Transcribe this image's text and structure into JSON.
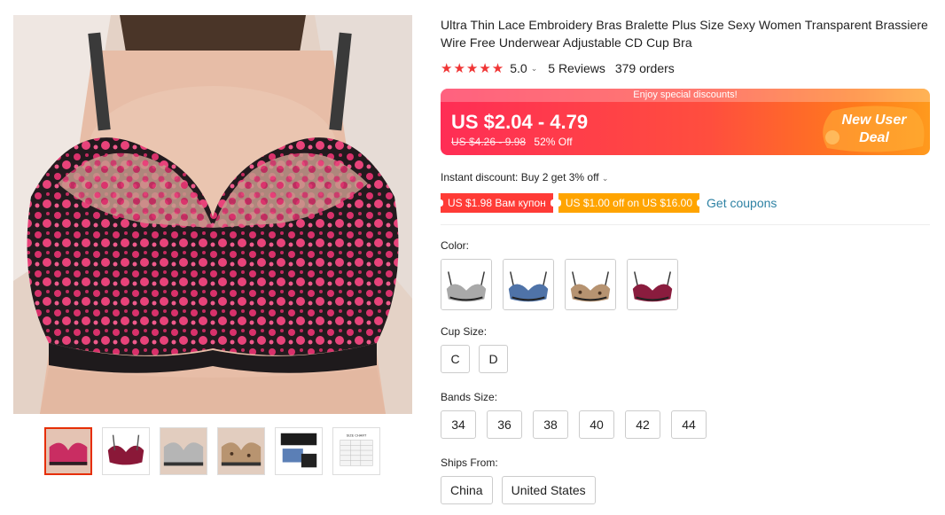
{
  "product": {
    "title": "Ultra Thin Lace Embroidery Bras Bralette Plus Size Sexy Women Transparent Brassiere Wire Free Underwear Adjustable CD Cup Bra",
    "stars": "★★★★★",
    "rating": "5.0",
    "reviews": "5 Reviews",
    "orders": "379 orders"
  },
  "price": {
    "banner_note": "Enjoy special discounts!",
    "current": "US $2.04 - 4.79",
    "original": "US $4.26 - 9.98",
    "discount": "52% Off",
    "deal_line1": "New User",
    "deal_line2": "Deal"
  },
  "promo": {
    "instant": "Instant discount: Buy 2 get 3% off",
    "coupon1": "US $1.98 Вам купон",
    "coupon2": "US $1.00 off on US $16.00",
    "get_coupons": "Get coupons"
  },
  "options": {
    "color_label": "Color:",
    "colors": [
      "grey",
      "blue",
      "leopard",
      "burgundy"
    ],
    "cup_label": "Cup Size:",
    "cups": [
      "C",
      "D"
    ],
    "band_label": "Bands Size:",
    "bands": [
      "34",
      "36",
      "38",
      "40",
      "42",
      "44"
    ],
    "ship_label": "Ships From:",
    "ships": [
      "China",
      "United States"
    ]
  },
  "gallery": {
    "thumbs": [
      "pink-main",
      "burgundy",
      "grey",
      "leopard",
      "product-set",
      "size-chart"
    ],
    "size_chart_label": "SIZE CHART"
  },
  "colors": {
    "accent": "#e62e04",
    "star": "#f03535",
    "link": "#2e82a4",
    "coupon_red": "#ff3b36",
    "coupon_orange": "#ffa400",
    "lace_pink": "#d9316b"
  }
}
